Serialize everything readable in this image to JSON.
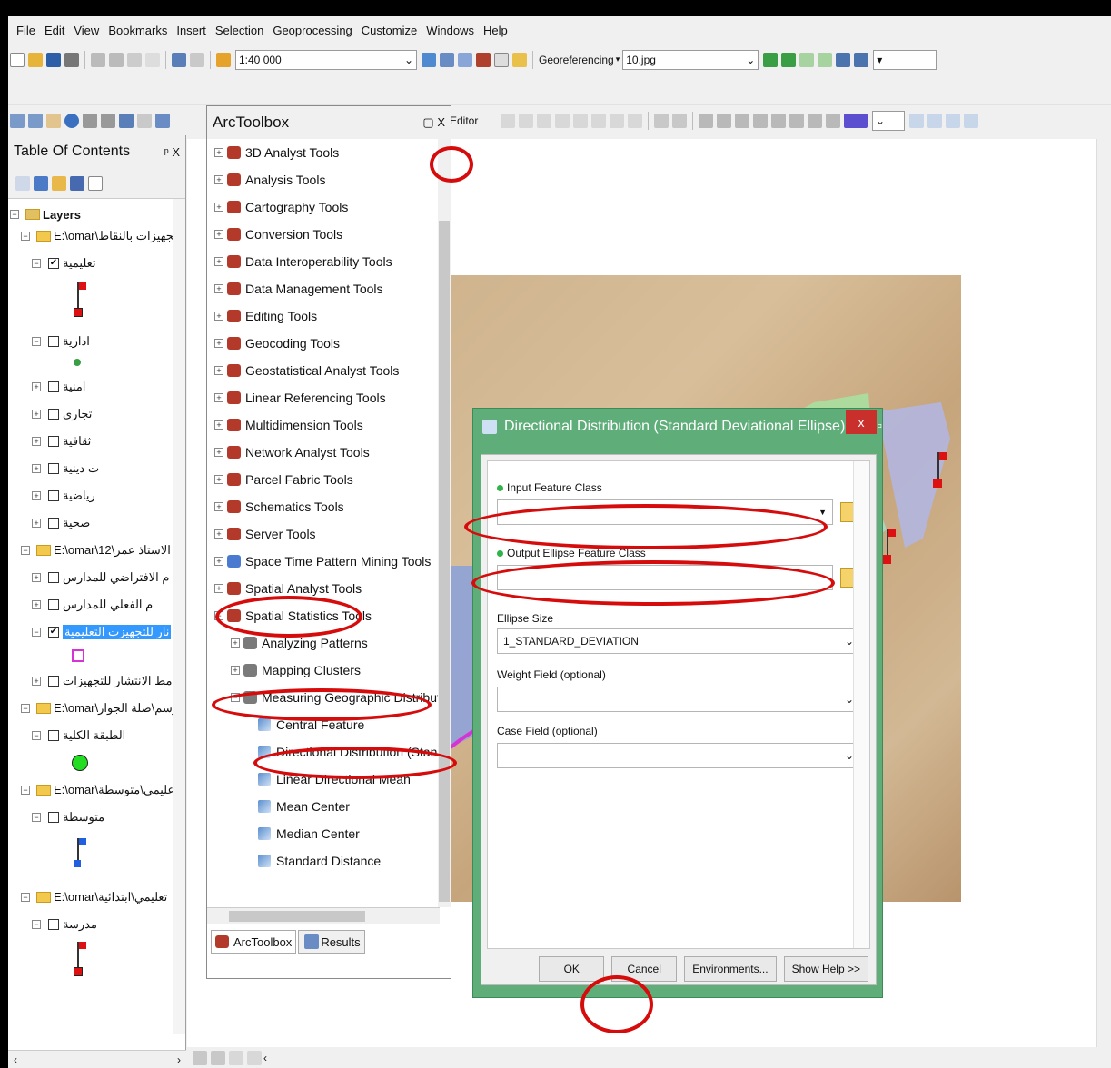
{
  "menu": [
    "File",
    "Edit",
    "View",
    "Bookmarks",
    "Insert",
    "Selection",
    "Geoprocessing",
    "Customize",
    "Windows",
    "Help"
  ],
  "toolbar": {
    "scale": "1:40 000",
    "georeferencing_label": "Georeferencing",
    "layer_combo": "10.jpg",
    "editor_label": "Editor"
  },
  "toc": {
    "title": "Table Of Contents",
    "pin": "p X",
    "root": "Layers",
    "rows": [
      "E:\\omar\\تجهيزات بالنقاط",
      "تعليمية",
      "ادارية",
      "امنية",
      "تجاري",
      "ثقافية",
      "ت دينية",
      "رياضية",
      "صحية",
      "E:\\omar\\12\\الاستاذ عمر",
      "م الافتراضي للمدارس",
      "م الفعلي للمدارس",
      "نار للتجهيزت التعليمية",
      "مط الانتشار للتجهيزات",
      "E:\\omar\\رسم\\صلة الجوار",
      "الطبقة الكلية",
      "E:\\omar\\عليمي\\متوسطة",
      "متوسطة",
      "E:\\omar\\تعليمي\\ابتدائية",
      "مدرسة"
    ]
  },
  "toolbox": {
    "title": "ArcToolbox",
    "items": [
      "3D Analyst Tools",
      "Analysis Tools",
      "Cartography Tools",
      "Conversion Tools",
      "Data Interoperability Tools",
      "Data Management Tools",
      "Editing Tools",
      "Geocoding Tools",
      "Geostatistical Analyst Tools",
      "Linear Referencing Tools",
      "Multidimension Tools",
      "Network Analyst Tools",
      "Parcel Fabric Tools",
      "Schematics Tools",
      "Server Tools",
      "Space Time Pattern Mining Tools",
      "Spatial Analyst Tools",
      "Spatial Statistics Tools"
    ],
    "subsets": [
      "Analyzing Patterns",
      "Mapping Clusters",
      "Measuring Geographic Distributions"
    ],
    "tools": [
      "Central Feature",
      "Directional Distribution (Standard De",
      "Linear Directional Mean",
      "Mean Center",
      "Median Center",
      "Standard Distance"
    ],
    "tabs": [
      "ArcToolbox",
      "Results"
    ]
  },
  "dialog": {
    "title": "Directional Distribution (Standard Deviational Ellipse)",
    "close": "x",
    "input_label": "Input Feature Class",
    "output_label": "Output Ellipse Feature Class",
    "ellipse_label": "Ellipse Size",
    "ellipse_value": "1_STANDARD_DEVIATION",
    "weight_label": "Weight Field (optional)",
    "case_label": "Case Field (optional)",
    "ok": "OK",
    "cancel": "Cancel",
    "environments": "Environments...",
    "show_help": "Show Help >>"
  },
  "colors": {
    "highlight": "#d60b0b",
    "dialog_frame": "#5fae7a",
    "close_button": "#c9302c"
  }
}
